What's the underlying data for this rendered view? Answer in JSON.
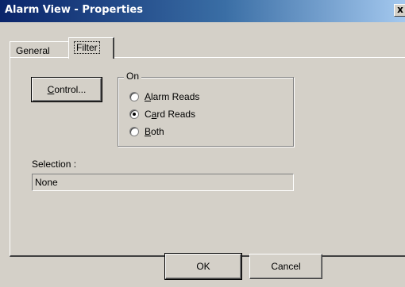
{
  "window": {
    "title": "Alarm View - Properties",
    "close_glyph": "x"
  },
  "tabs": [
    {
      "label": "General",
      "active": false
    },
    {
      "label": "Filter",
      "active": true
    }
  ],
  "filter": {
    "control_button": {
      "mnemonic": "C",
      "rest": "ontrol..."
    },
    "on_group": {
      "legend": "On",
      "options": [
        {
          "mnemonic": "A",
          "rest": "larm Reads",
          "checked": false
        },
        {
          "pre": "C",
          "mnemonic": "a",
          "rest": "rd Reads",
          "checked": true
        },
        {
          "mnemonic": "B",
          "rest": "oth",
          "checked": false
        }
      ]
    },
    "selection": {
      "label": "Selection :",
      "value": "None"
    }
  },
  "buttons": {
    "ok": "OK",
    "cancel": "Cancel"
  }
}
